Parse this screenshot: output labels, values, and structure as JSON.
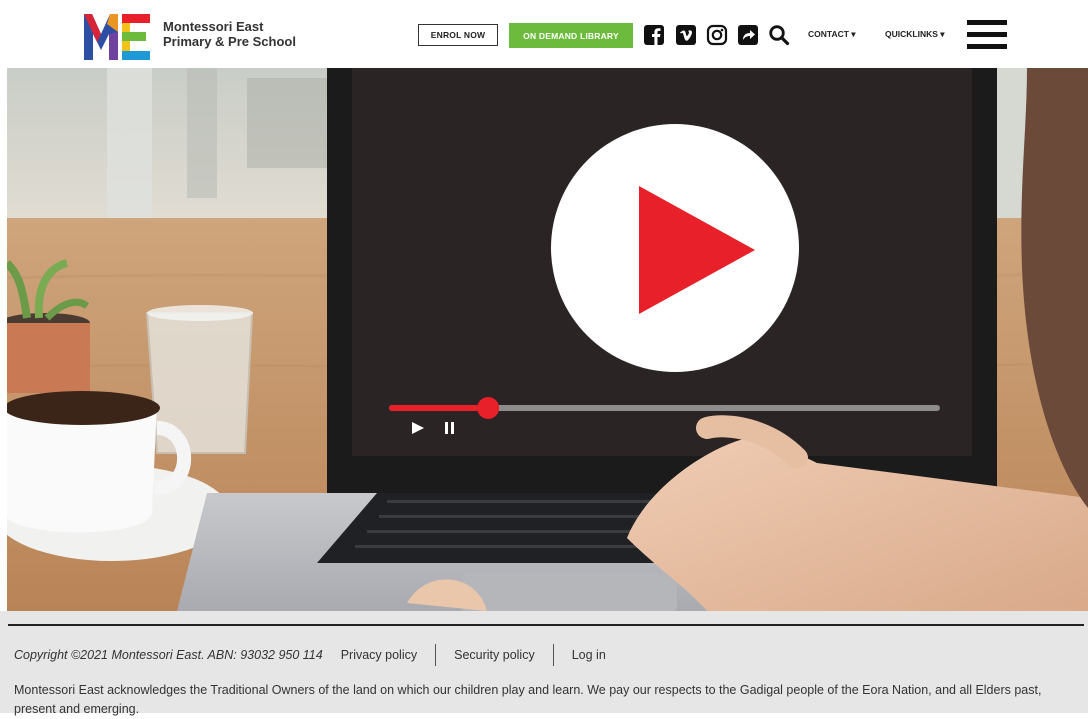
{
  "header": {
    "logo_letters": "ME",
    "school_name_line1": "Montessori East",
    "school_name_line2": "Primary & Pre School",
    "enrol_label": "ENROL NOW",
    "library_label": "ON DEMAND LIBRARY",
    "social_icons": [
      "facebook-icon",
      "vimeo-icon",
      "instagram-icon",
      "share-icon",
      "search-icon"
    ],
    "contact_label": "CONTACT ▾",
    "quicklinks_label": "QUICKLINKS ▾",
    "accent_green": "#6dbb3c"
  },
  "hero": {
    "player_progress": 0.18,
    "play_color": "#e8202a"
  },
  "footer": {
    "copyright": "Copyright ©2021 Montessori East. ABN: 93032 950 114",
    "privacy": "Privacy policy",
    "security": "Security policy",
    "login": "Log in",
    "acknowledgement": "Montessori East acknowledges the Traditional Owners of the land on which our children play and learn. We pay our respects to the Gadigal people of the Eora Nation, and all Elders past, present and emerging."
  }
}
